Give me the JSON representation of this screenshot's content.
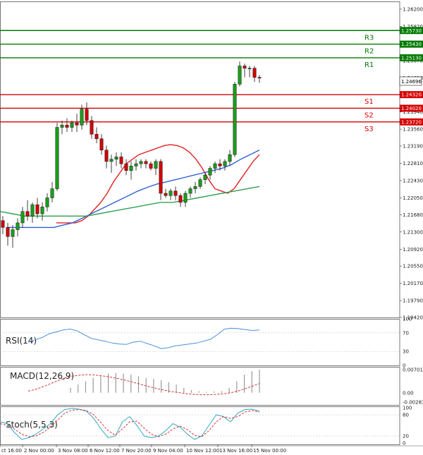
{
  "chart_data": [
    {
      "type": "candlestick",
      "title": "",
      "price_ticks": [
        "1.26200",
        "1.25820",
        "1.25450",
        "1.25070",
        "1.24690",
        "1.24320",
        "1.23940",
        "1.23560",
        "1.23190",
        "1.22810",
        "1.22430",
        "1.22050",
        "1.21680",
        "1.21300",
        "1.20920",
        "1.20550",
        "1.20170",
        "1.19790",
        "1.19420"
      ],
      "ylim": [
        1.1942,
        1.2637
      ],
      "time_labels": [
        "ct 16:00",
        "2 Nov 00:00",
        "3 Nov 08:00",
        "6 Nov 12:00",
        "7 Nov 20:00",
        "9 Nov 04:00",
        "10 Nov 12:00",
        "13 Nov 16:00",
        "15 Nov 00:00"
      ],
      "current_price": "1.24696",
      "colors": {
        "bull": "#1a9e1a",
        "bear": "#d40000",
        "resistance": "#007a00",
        "support": "#d40000",
        "ma_fast": "#e02020",
        "ma_mid": "#3060d0",
        "ma_slow": "#30a050"
      },
      "levels": [
        {
          "name": "R3",
          "value": 1.2573,
          "tag": "1.25730",
          "kind": "resistance"
        },
        {
          "name": "R2",
          "value": 1.2543,
          "tag": "1.25430",
          "kind": "resistance"
        },
        {
          "name": "R1",
          "value": 1.2513,
          "tag": "1.25130",
          "kind": "resistance"
        },
        {
          "name": "S1",
          "value": 1.2432,
          "tag": "1.24320",
          "kind": "support"
        },
        {
          "name": "S2",
          "value": 1.2402,
          "tag": "1.24020",
          "kind": "support"
        },
        {
          "name": "S3",
          "value": 1.2372,
          "tag": "1.23720",
          "kind": "support"
        }
      ],
      "candles": [
        [
          1.2155,
          1.2165,
          1.2125,
          1.214
        ],
        [
          1.214,
          1.215,
          1.21,
          1.212
        ],
        [
          1.212,
          1.2145,
          1.2095,
          1.2135
        ],
        [
          1.2135,
          1.216,
          1.212,
          1.215
        ],
        [
          1.215,
          1.2185,
          1.214,
          1.2175
        ],
        [
          1.2175,
          1.22,
          1.2155,
          1.2165
        ],
        [
          1.2165,
          1.2195,
          1.215,
          1.219
        ],
        [
          1.219,
          1.2205,
          1.216,
          1.217
        ],
        [
          1.217,
          1.2195,
          1.2155,
          1.2185
        ],
        [
          1.2185,
          1.2215,
          1.2175,
          1.2205
        ],
        [
          1.2205,
          1.224,
          1.2195,
          1.2225
        ],
        [
          1.2225,
          1.237,
          1.222,
          1.236
        ],
        [
          1.236,
          1.2375,
          1.2345,
          1.2365
        ],
        [
          1.2365,
          1.238,
          1.235,
          1.236
        ],
        [
          1.236,
          1.2375,
          1.235,
          1.237
        ],
        [
          1.237,
          1.239,
          1.235,
          1.2365
        ],
        [
          1.2365,
          1.241,
          1.2355,
          1.24
        ],
        [
          1.24,
          1.2415,
          1.2365,
          1.2375
        ],
        [
          1.2375,
          1.2385,
          1.2335,
          1.2345
        ],
        [
          1.2345,
          1.236,
          1.2325,
          1.2335
        ],
        [
          1.2335,
          1.2345,
          1.23,
          1.231
        ],
        [
          1.231,
          1.232,
          1.227,
          1.2285
        ],
        [
          1.2285,
          1.23,
          1.226,
          1.229
        ],
        [
          1.229,
          1.2305,
          1.2275,
          1.2295
        ],
        [
          1.2295,
          1.2305,
          1.227,
          1.228
        ],
        [
          1.228,
          1.229,
          1.2255,
          1.2265
        ],
        [
          1.2265,
          1.2285,
          1.2245,
          1.2275
        ],
        [
          1.2275,
          1.229,
          1.2265,
          1.228
        ],
        [
          1.228,
          1.229,
          1.227,
          1.2285
        ],
        [
          1.2285,
          1.229,
          1.227,
          1.228
        ],
        [
          1.228,
          1.2285,
          1.2265,
          1.227
        ],
        [
          1.227,
          1.229,
          1.2255,
          1.2285
        ],
        [
          1.2285,
          1.229,
          1.22,
          1.2215
        ],
        [
          1.2215,
          1.2225,
          1.2205,
          1.221
        ],
        [
          1.221,
          1.2225,
          1.22,
          1.222
        ],
        [
          1.222,
          1.223,
          1.22,
          1.221
        ],
        [
          1.221,
          1.2215,
          1.2185,
          1.2195
        ],
        [
          1.2195,
          1.222,
          1.2185,
          1.2215
        ],
        [
          1.2215,
          1.223,
          1.2205,
          1.2225
        ],
        [
          1.2225,
          1.224,
          1.2215,
          1.223
        ],
        [
          1.223,
          1.225,
          1.2225,
          1.2245
        ],
        [
          1.2245,
          1.226,
          1.2235,
          1.2255
        ],
        [
          1.2255,
          1.2275,
          1.2245,
          1.227
        ],
        [
          1.227,
          1.2285,
          1.226,
          1.228
        ],
        [
          1.228,
          1.229,
          1.2265,
          1.2275
        ],
        [
          1.2275,
          1.229,
          1.2265,
          1.2285
        ],
        [
          1.2285,
          1.231,
          1.2275,
          1.23
        ],
        [
          1.23,
          1.246,
          1.2295,
          1.2455
        ],
        [
          1.2455,
          1.2505,
          1.245,
          1.2495
        ],
        [
          1.2495,
          1.25,
          1.247,
          1.249
        ],
        [
          1.249,
          1.2495,
          1.247,
          1.249
        ],
        [
          1.249,
          1.2495,
          1.246,
          1.247
        ],
        [
          1.247,
          1.2475,
          1.2458,
          1.2469
        ]
      ],
      "moving_averages": [
        {
          "color": "#e02020",
          "values": [
            1.215,
            1.215,
            1.215,
            1.215,
            1.2155,
            1.2165,
            1.218,
            1.2195,
            1.2215,
            1.224,
            1.226,
            1.228,
            1.229,
            1.23,
            1.2305,
            1.231,
            1.2315,
            1.232,
            1.2322,
            1.232,
            1.2315,
            1.2305,
            1.229,
            1.227,
            1.2245,
            1.2225,
            1.222,
            1.2215,
            1.2225,
            1.2245,
            1.2265,
            1.2285,
            1.23
          ]
        },
        {
          "color": "#3060d0",
          "values": [
            1.214,
            1.214,
            1.214,
            1.214,
            1.214,
            1.214,
            1.2145,
            1.215,
            1.216,
            1.217,
            1.218,
            1.219,
            1.22,
            1.221,
            1.222,
            1.2228,
            1.2235,
            1.224,
            1.2245,
            1.225,
            1.2255,
            1.226,
            1.2265,
            1.227,
            1.2278,
            1.229,
            1.23,
            1.231
          ]
        },
        {
          "color": "#30a050",
          "values": [
            1.2175,
            1.217,
            1.2165,
            1.2165,
            1.2165,
            1.2165,
            1.2165,
            1.2165,
            1.217,
            1.2175,
            1.218,
            1.2185,
            1.219,
            1.2195,
            1.2195,
            1.22,
            1.2205,
            1.221,
            1.2215,
            1.222,
            1.2225,
            1.223
          ]
        }
      ]
    },
    {
      "type": "line",
      "name": "RSI(14)",
      "ticks": [
        "100",
        "70",
        "30",
        "0"
      ],
      "ylim": [
        0,
        100
      ],
      "series": [
        {
          "color": "#4a90d8",
          "values": [
            50,
            55,
            60,
            68,
            72,
            76,
            78,
            74,
            66,
            58,
            55,
            52,
            48,
            46,
            45,
            50,
            52,
            47,
            42,
            36,
            38,
            42,
            44,
            46,
            48,
            52,
            56,
            66,
            78,
            80,
            79,
            77,
            75,
            76
          ]
        }
      ]
    },
    {
      "type": "histogram-line",
      "name": "MACD(12,26,9)",
      "ticks": [
        "0.007015",
        "0.00",
        "-0.002831"
      ],
      "ylim": [
        -0.002831,
        0.007015
      ],
      "histogram": [
        0.0015,
        0.0025,
        0.0035,
        0.0045,
        0.0052,
        0.0058,
        0.006,
        0.0058,
        0.0055,
        0.005,
        0.0045,
        0.0042,
        0.0038,
        0.0032,
        0.0025,
        0.0015,
        0.0008,
        0.0005,
        0.0003,
        0.0004,
        0.0005,
        0.0015,
        0.0035,
        0.0055,
        0.0065,
        0.007
      ],
      "signal": [
        0.0005,
        0.001,
        0.0018,
        0.0027,
        0.0036,
        0.0044,
        0.005,
        0.0053,
        0.0055,
        0.0054,
        0.0052,
        0.0049,
        0.0045,
        0.004,
        0.0035,
        0.0029,
        0.0023,
        0.0017,
        0.0012,
        0.0007,
        0.0003,
        0.0,
        -0.0003,
        -0.0005,
        -0.0006,
        -0.0006,
        -0.0005,
        -0.0003,
        0.0,
        0.0005,
        0.0012,
        0.002,
        0.0028
      ]
    },
    {
      "type": "line",
      "name": "Stoch(5,5,3)",
      "ticks": [
        "100",
        "80",
        "20",
        "0"
      ],
      "ylim": [
        0,
        100
      ],
      "series": [
        {
          "color": "#30a8c8",
          "values": [
            60,
            55,
            30,
            10,
            15,
            25,
            40,
            55,
            80,
            95,
            98,
            96,
            90,
            70,
            40,
            15,
            20,
            60,
            75,
            50,
            20,
            15,
            20,
            35,
            55,
            45,
            25,
            10,
            20,
            50,
            80,
            75,
            60,
            85,
            95,
            96,
            90
          ]
        },
        {
          "color": "#e03030",
          "values": [
            55,
            50,
            40,
            25,
            18,
            20,
            30,
            45,
            65,
            85,
            93,
            95,
            92,
            80,
            58,
            35,
            22,
            40,
            60,
            62,
            42,
            25,
            18,
            25,
            40,
            48,
            38,
            22,
            18,
            35,
            60,
            75,
            70,
            75,
            88,
            92,
            88
          ]
        }
      ]
    }
  ]
}
